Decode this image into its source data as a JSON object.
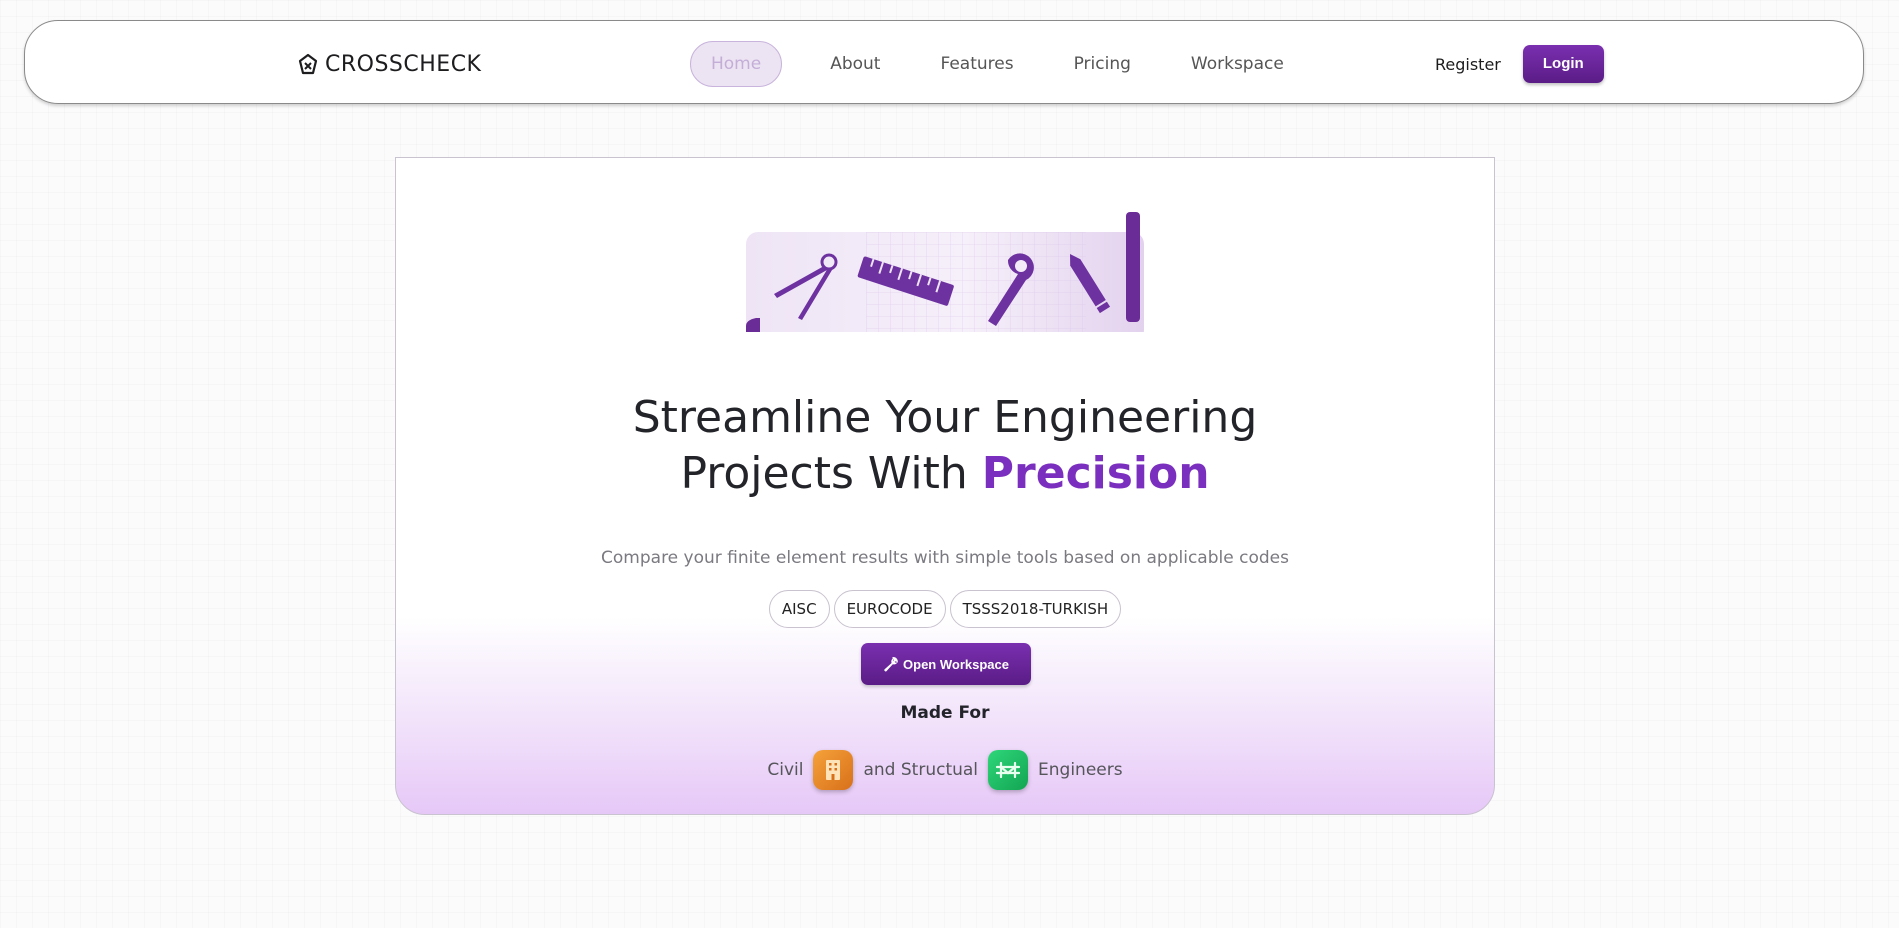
{
  "brand": {
    "name": "CROSSCHECK"
  },
  "nav": {
    "links": [
      {
        "label": "Home",
        "active": true
      },
      {
        "label": "About"
      },
      {
        "label": "Features"
      },
      {
        "label": "Pricing"
      },
      {
        "label": "Workspace"
      }
    ],
    "register_label": "Register",
    "login_label": "Login"
  },
  "hero": {
    "headline_line1": "Streamline Your Engineering",
    "headline_line2_prefix": "Projects With ",
    "headline_accent": "Precision",
    "subtitle": "Compare your finite element results with simple tools based on applicable codes",
    "codes": [
      "AISC",
      "EUROCODE",
      "TSSS2018-TURKISH"
    ],
    "cta_label": "Open Workspace",
    "made_for_label": "Made For",
    "audience": {
      "civil": "Civil",
      "middle": "and Structual",
      "end": "Engineers"
    }
  },
  "colors": {
    "accent": "#7b2fbe",
    "button": "#6a25a0",
    "civil_badge": "#e8861f",
    "structural_badge": "#18b85e"
  },
  "icons": [
    "crosscheck-logo-icon",
    "compass-icon",
    "ruler-icon",
    "wrench-icon",
    "pencil-icon",
    "wrench-small-icon",
    "building-icon",
    "bridge-icon"
  ]
}
